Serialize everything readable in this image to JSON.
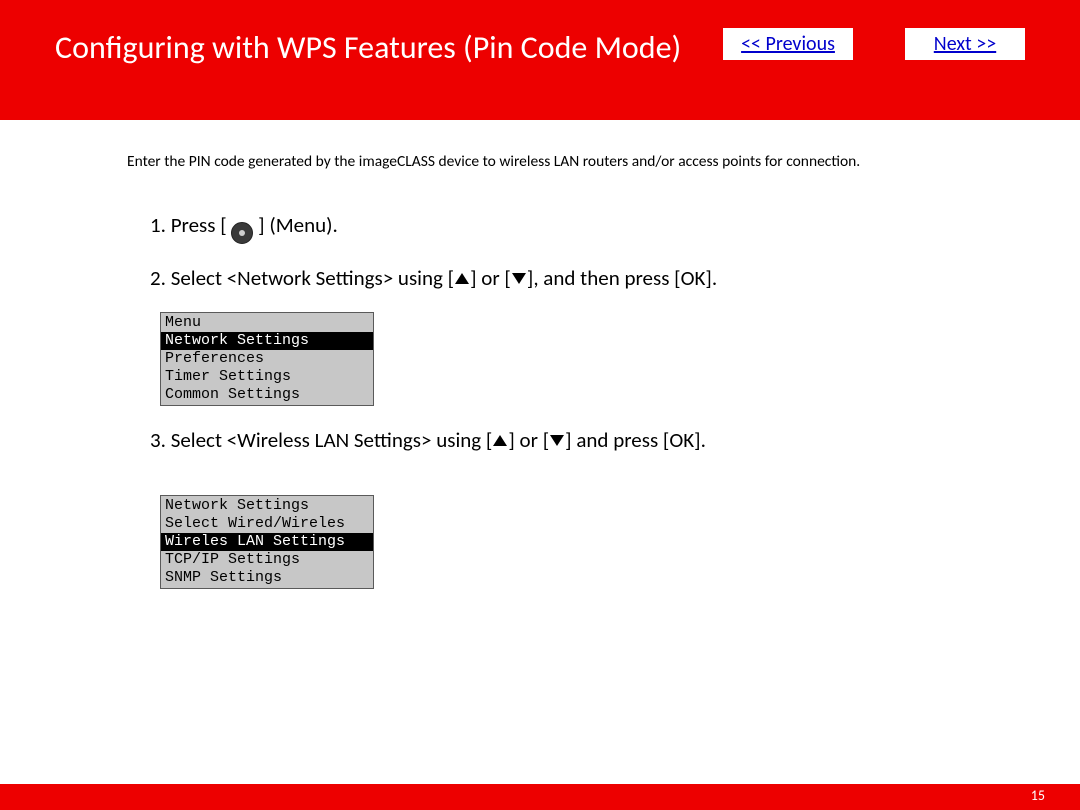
{
  "header": {
    "title": "Configuring with WPS Features (Pin Code Mode)",
    "prev": "<< Previous",
    "next": "Next >>"
  },
  "intro": "Enter the PIN code generated by the imageCLASS device to wireless LAN routers and/or access points for connection.",
  "steps": {
    "s1a": "1. Press [",
    "s1b": "] (Menu).",
    "s2a": "2. Select <Network Settings> using [",
    "s2b": "] or [",
    "s2c": "], and then press [OK].",
    "s3a": "3. Select <Wireless LAN Settings> using [",
    "s3b": "] or [",
    "s3c": "] and press [OK]."
  },
  "menu1": {
    "title": "Menu",
    "r1": "Network Settings",
    "r2": "Preferences",
    "r3": "Timer Settings",
    "r4": "Common Settings"
  },
  "menu2": {
    "title": "Network Settings",
    "r1": "Select Wired/Wireles",
    "r2": "Wireles LAN Settings",
    "r3": "TCP/IP Settings",
    "r4": "SNMP Settings"
  },
  "page_number": "15"
}
